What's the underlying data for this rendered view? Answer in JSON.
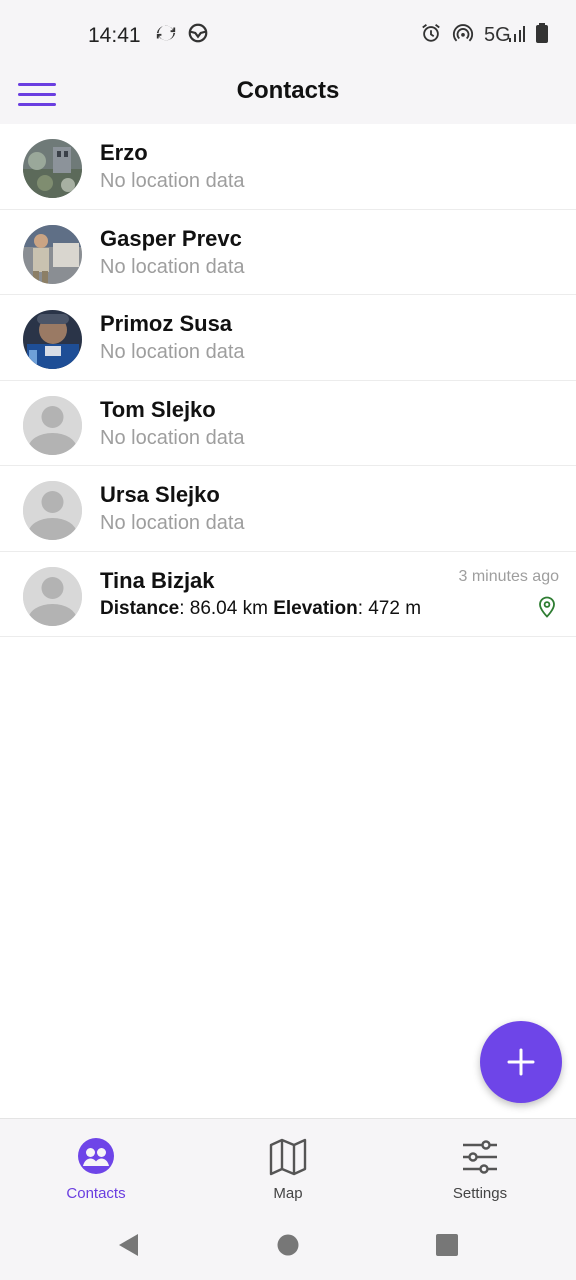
{
  "status_bar": {
    "time": "14:41",
    "network": "5G",
    "icons": [
      "sync-icon",
      "steering-icon",
      "alarm-icon",
      "hotspot-icon",
      "signal-icon",
      "battery-icon"
    ]
  },
  "app_bar": {
    "title": "Contacts",
    "menu_icon": "hamburger-menu-icon"
  },
  "contacts": [
    {
      "name": "Erzo",
      "status": "No location data",
      "avatar": "photo"
    },
    {
      "name": "Gasper Prevc",
      "status": "No location data",
      "avatar": "photo"
    },
    {
      "name": "Primoz Susa",
      "status": "No location data",
      "avatar": "photo"
    },
    {
      "name": "Tom Slejko",
      "status": "No location data",
      "avatar": "placeholder"
    },
    {
      "name": "Ursa Slejko",
      "status": "No location data",
      "avatar": "placeholder"
    },
    {
      "name": "Tina Bizjak",
      "avatar": "placeholder",
      "time": "3 minutes ago",
      "distance_label": "Distance",
      "distance_value": ": 86.04 km",
      "elevation_label": "Elevation",
      "elevation_value": ": 472 m",
      "icon": "location-pin-icon"
    }
  ],
  "fab": {
    "icon": "plus-icon"
  },
  "bottom_nav": {
    "items": [
      {
        "label": "Contacts",
        "icon": "contacts-icon",
        "active": true
      },
      {
        "label": "Map",
        "icon": "map-icon",
        "active": false
      },
      {
        "label": "Settings",
        "icon": "sliders-icon",
        "active": false
      }
    ]
  },
  "system_nav": {
    "icons": [
      "back-icon",
      "home-icon",
      "recents-icon"
    ]
  },
  "colors": {
    "accent": "#6e45e8",
    "pin": "#2e7d32",
    "muted_text": "#9e9e9e",
    "bar_background": "#f6f5f7"
  }
}
